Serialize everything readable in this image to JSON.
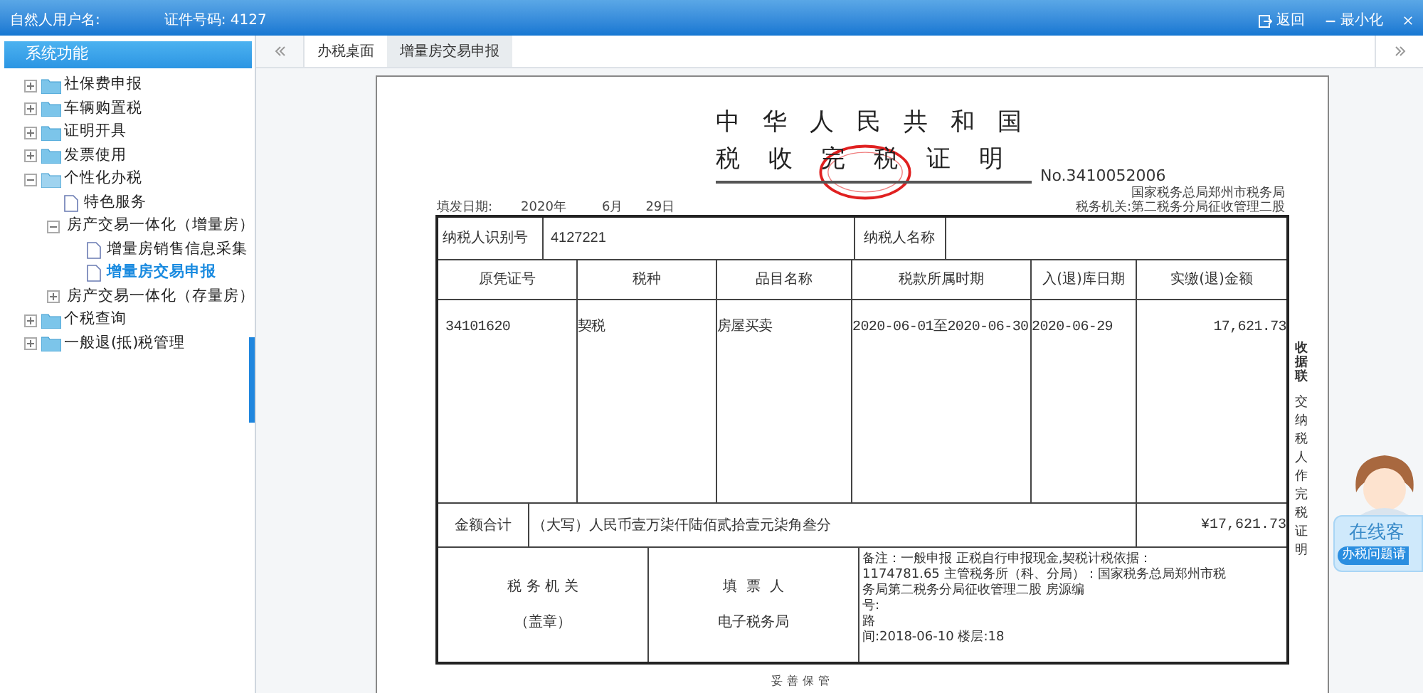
{
  "header": {
    "user_label": "自然人用户名:",
    "id_label": "证件号码: 4127",
    "actions": [
      {
        "kind": "back",
        "label": "返回"
      },
      {
        "kind": "minimize",
        "label": "最小化"
      },
      {
        "kind": "close"
      }
    ]
  },
  "sidebar": {
    "title": "系统功能",
    "tree": [
      {
        "label": "社保费申报",
        "kind": "folder",
        "expanded": false,
        "selected": false
      },
      {
        "label": "车辆购置税",
        "kind": "folder",
        "expanded": false,
        "selected": false
      },
      {
        "label": "证明开具",
        "kind": "folder",
        "expanded": false,
        "selected": false
      },
      {
        "label": "发票使用",
        "kind": "folder",
        "expanded": false,
        "selected": false
      },
      {
        "label": "个性化办税",
        "kind": "folder",
        "expanded": true,
        "selected": false,
        "children": [
          {
            "label": "特色服务",
            "kind": "file",
            "selected": false
          },
          {
            "label": "房产交易一体化（增量房）",
            "kind": "folder",
            "expanded": true,
            "selected": false,
            "children": [
              {
                "label": "增量房销售信息采集",
                "kind": "file",
                "selected": false
              },
              {
                "label": "增量房交易申报",
                "kind": "file",
                "selected": true
              }
            ]
          },
          {
            "label": "房产交易一体化（存量房）",
            "kind": "folder",
            "expanded": false,
            "selected": false
          }
        ]
      },
      {
        "label": "个税查询",
        "kind": "folder",
        "expanded": false,
        "selected": false
      },
      {
        "label": "一般退(抵)税管理",
        "kind": "folder",
        "expanded": false,
        "selected": false
      }
    ]
  },
  "tabs": [
    {
      "label": "办税桌面",
      "selected": false
    },
    {
      "label": "增量房交易申报",
      "selected": true
    }
  ],
  "document": {
    "title_1": "中华人民共和国",
    "title_2": "税收完税证明",
    "number": "No.3410052006",
    "issue_date": [
      "填发日期:",
      "2020年",
      "6月",
      "29日"
    ],
    "authority_1": "国家税务总局郑州市税务局",
    "authority_2": "税务机关:第二税务分局征收管理二股",
    "taxpayer_id_label": "纳税人识别号",
    "taxpayer_id": "4127221",
    "taxpayer_name_label": "纳税人名称",
    "columns": [
      "原凭证号",
      "税种",
      "品目名称",
      "税款所属时期",
      "入(退)库日期",
      "实缴(退)金额"
    ],
    "rows": [
      [
        "34101620",
        "契税",
        "房屋买卖",
        "2020-06-01至2020-06-30",
        "2020-06-29",
        "17,621.73"
      ]
    ],
    "total_label": "金额合计",
    "total_words": "（大写）人民币壹万柒仟陆佰贰拾壹元柒角叁分",
    "total_amount": "¥17,621.73",
    "authority_label": "税 务 机 关",
    "seal_label": "（盖章）",
    "filler_label": "填  票  人",
    "filler": "电子税务局",
    "remarks": [
      "备注：一般申报 正税自行申报现金,契税计税依据：",
      "1174781.65 主管税务所（科、分局）：国家税务总局郑州市税",
      "务局第二税务分局征收管理二股 房源编",
      "号:",
      "路",
      "间:2018-06-10 楼层:18"
    ],
    "keep_note": "妥善保管",
    "side_title": "收据联",
    "side_note": "交纳税人作完税证明"
  },
  "chat": {
    "title": "在线客",
    "subtitle": "办税问题请"
  }
}
